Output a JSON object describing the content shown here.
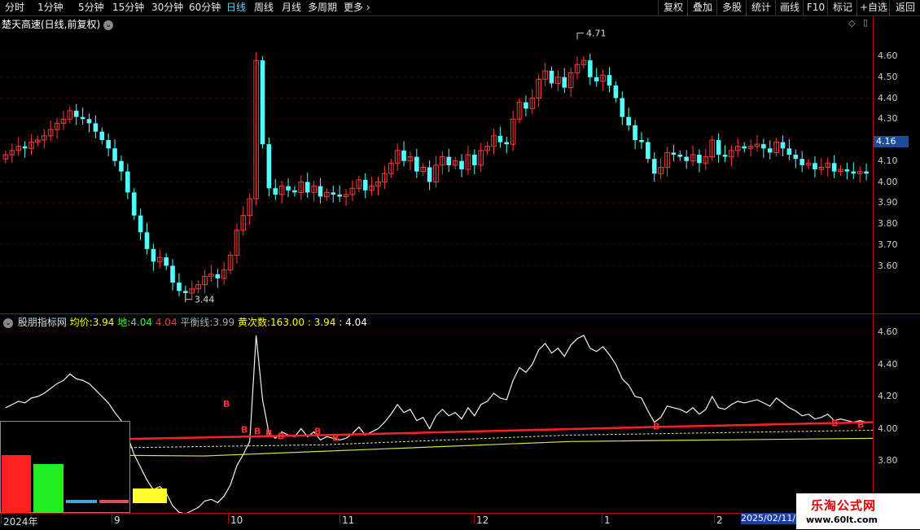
{
  "toolbar": {
    "periods": [
      "分时",
      "1分钟",
      "5分钟",
      "15分钟",
      "30分钟",
      "60分钟",
      "日线",
      "周线",
      "月线",
      "多周期",
      "更多"
    ],
    "active": "日线",
    "right": [
      "复权",
      "叠加",
      "多股",
      "统计",
      "画线",
      "F10",
      "标记",
      "+自选",
      "返回"
    ]
  },
  "main": {
    "title": "楚天高速(日线,前复权)",
    "price_axis": [
      "4.60",
      "4.50",
      "4.40",
      "4.30",
      "4.20",
      "4.10",
      "4.00",
      "3.90",
      "3.80",
      "3.70",
      "3.60"
    ],
    "current_price": "4.16",
    "high_label": "4.71",
    "low_label": "3.44",
    "colors": {
      "up": "#ff3b3b",
      "down": "#54ffff"
    }
  },
  "indicator": {
    "name": "股朋指标网",
    "avg_label": "均价:",
    "avg_value": "3.94",
    "ground_label": "地:",
    "ground_value": "4.04",
    "red_value": "4.04",
    "balance_label": "平衡线:",
    "balance_value": "3.99",
    "yellow_label": "黄次数:",
    "yellow_value": "163.00",
    "v1": "3.94",
    "v2": "4.04",
    "axis": [
      "4.60",
      "4.40",
      "4.20",
      "4.00",
      "3.80"
    ],
    "marker": "B"
  },
  "dates": {
    "labels": [
      "2024年",
      "9",
      "10",
      "11",
      "12",
      "1",
      "2"
    ],
    "selected": "2025/02/11/"
  },
  "watermark": {
    "line1": "乐淘公式网",
    "line2": "www.60lt.com"
  }
}
